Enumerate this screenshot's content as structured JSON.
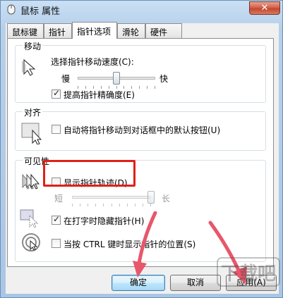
{
  "window": {
    "title": "鼠标 属性",
    "close_glyph": "✕"
  },
  "tabs": [
    {
      "label": "鼠标键"
    },
    {
      "label": "指针"
    },
    {
      "label": "指针选项"
    },
    {
      "label": "滑轮"
    },
    {
      "label": "硬件"
    }
  ],
  "active_tab": "指针选项",
  "motion": {
    "group_label": "移动",
    "speed_label": "选择指针移动速度(C):",
    "slow": "慢",
    "fast": "快",
    "speed_level": 0.5,
    "precision_label": "提高指针精确度(E)",
    "precision_checked": true
  },
  "snap": {
    "group_label": "对齐",
    "snap_label": "自动将指针移动到对话框中的默认按钮(U)",
    "snap_checked": false
  },
  "visibility": {
    "group_label": "可见性",
    "trails_label": "显示指针轨迹(D)",
    "trails_checked": false,
    "short": "短",
    "long": "长",
    "trails_level": 1.0,
    "hide_typing_label": "在打字时隐藏指针(H)",
    "hide_typing_checked": true,
    "ctrl_label": "当按 CTRL 键时显示指针的位置(S)",
    "ctrl_checked": false
  },
  "buttons": {
    "ok": "确定",
    "cancel": "取消",
    "apply": "应用(A)"
  },
  "watermark": {
    "text": "下载吧"
  },
  "colors": {
    "highlight": "#e02018",
    "arrow": "#e8566a"
  }
}
